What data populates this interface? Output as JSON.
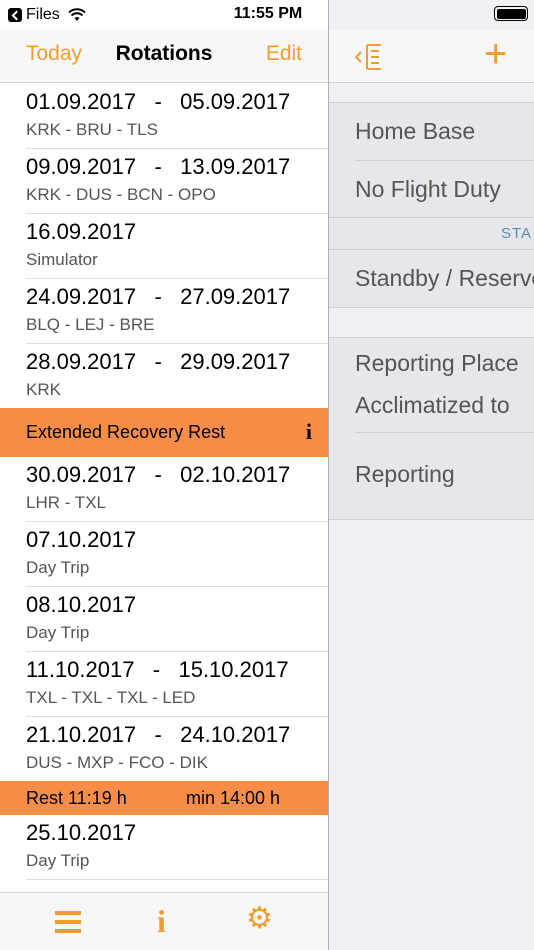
{
  "statusbar": {
    "carrier": "Files",
    "time": "11:55 PM"
  },
  "nav": {
    "today": "Today",
    "title": "Rotations",
    "edit": "Edit"
  },
  "rows_a": [
    {
      "dates": "01.09.2017   -   05.09.2017",
      "sub": "KRK - BRU - TLS"
    },
    {
      "dates": "09.09.2017   -   13.09.2017",
      "sub": "KRK - DUS - BCN - OPO"
    },
    {
      "dates": "16.09.2017",
      "sub": "Simulator"
    },
    {
      "dates": "24.09.2017   -   27.09.2017",
      "sub": "BLQ - LEJ - BRE"
    },
    {
      "dates": "28.09.2017   -   29.09.2017",
      "sub": "KRK"
    }
  ],
  "banner": {
    "text": "Extended Recovery Rest",
    "icon": "info-icon"
  },
  "rows_b": [
    {
      "dates": "30.09.2017   -   02.10.2017",
      "sub": "LHR - TXL"
    },
    {
      "dates": "07.10.2017",
      "sub": "Day Trip"
    },
    {
      "dates": "08.10.2017",
      "sub": "Day Trip"
    },
    {
      "dates": "11.10.2017   -   15.10.2017",
      "sub": "TXL - TXL - TXL - LED"
    },
    {
      "dates": "21.10.2017   -   24.10.2017",
      "sub": "DUS - MXP - FCO - DIK"
    }
  ],
  "rest": {
    "label": "Rest  11:19 h",
    "min": "min 14:00 h"
  },
  "rows_c": [
    {
      "dates": "25.10.2017",
      "sub": "Day Trip"
    }
  ],
  "tabbar": {
    "icons": [
      "list-icon",
      "info-icon",
      "gear-icon"
    ]
  },
  "right": {
    "group1": [
      "Home Base",
      "No Flight Duty"
    ],
    "header": "STA",
    "group2": [
      "Standby / Reserve"
    ],
    "group3": [
      "Reporting Place",
      "Acclimatized to"
    ],
    "group4": [
      "Reporting"
    ]
  },
  "colors": {
    "accent": "#f29c30",
    "banner": "#f88d47"
  }
}
